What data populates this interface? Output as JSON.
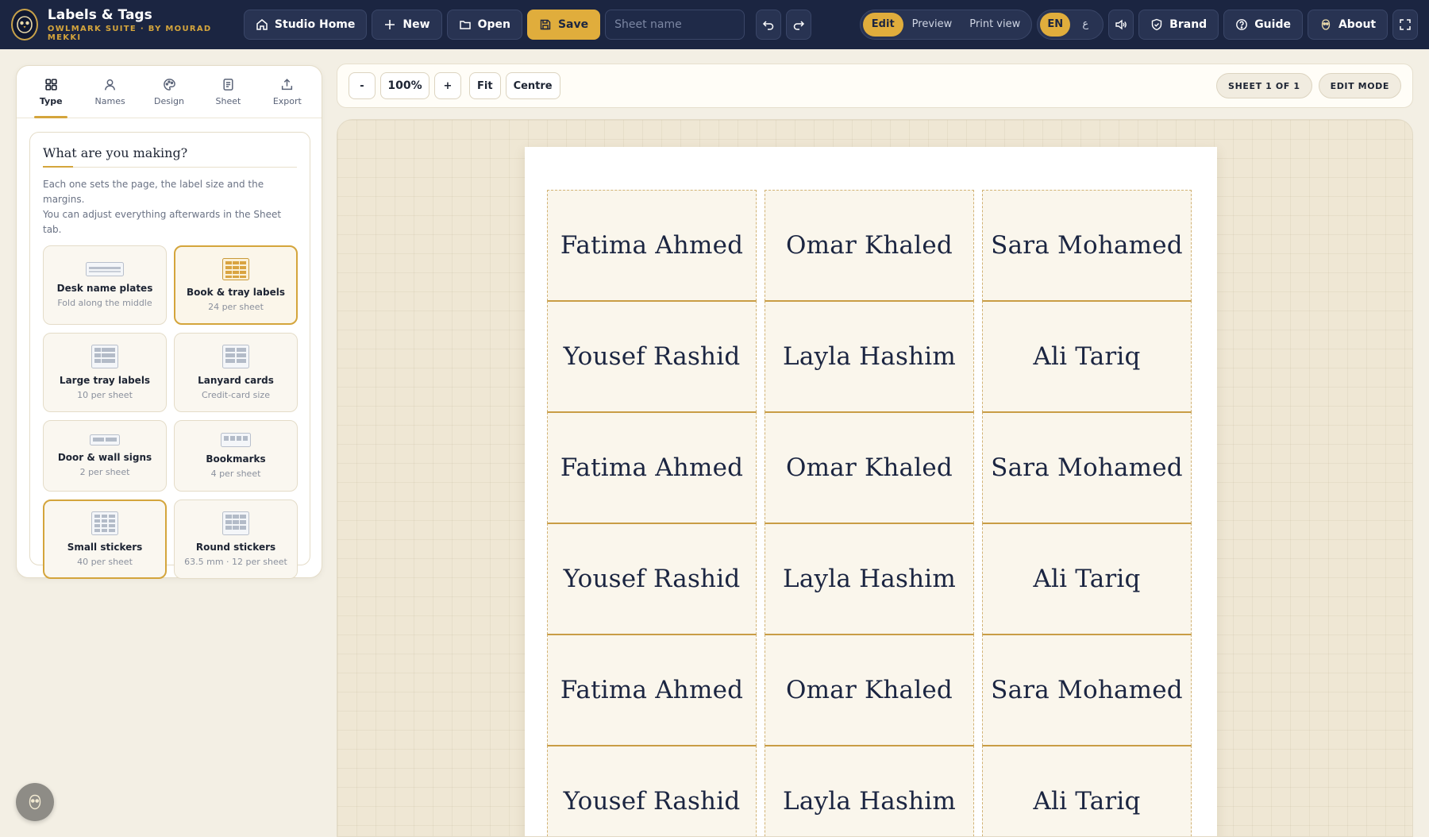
{
  "app": {
    "title": "Labels & Tags",
    "subtitle": "OWLMARK SUITE · BY MOURAD MEKKI"
  },
  "topbar": {
    "studio_home": "Studio Home",
    "new": "New",
    "open": "Open",
    "save": "Save",
    "sheet_name_value": "",
    "sheet_name_placeholder": "Sheet name",
    "modes": [
      "Edit",
      "Preview",
      "Print view"
    ],
    "active_mode": "Edit",
    "languages": [
      "EN",
      "ع"
    ],
    "active_language": "EN",
    "brand": "Brand",
    "guide": "Guide",
    "about": "About"
  },
  "sidebar": {
    "tabs": [
      {
        "label": "Type",
        "icon": "grid-icon",
        "active": true
      },
      {
        "label": "Names",
        "icon": "user-icon",
        "active": false
      },
      {
        "label": "Design",
        "icon": "palette-icon",
        "active": false
      },
      {
        "label": "Sheet",
        "icon": "document-icon",
        "active": false
      },
      {
        "label": "Export",
        "icon": "upload-icon",
        "active": false
      }
    ],
    "heading": "What are you making?",
    "description_line1": "Each one sets the page, the label size and the margins.",
    "description_line2": "You can adjust everything afterwards in the Sheet tab.",
    "types": [
      {
        "name": "Desk name plates",
        "sub": "Fold along the middle"
      },
      {
        "name": "Book & tray labels",
        "sub": "24 per sheet"
      },
      {
        "name": "Large tray labels",
        "sub": "10 per sheet"
      },
      {
        "name": "Lanyard cards",
        "sub": "Credit-card size"
      },
      {
        "name": "Door & wall signs",
        "sub": "2 per sheet"
      },
      {
        "name": "Bookmarks",
        "sub": "4 per sheet"
      },
      {
        "name": "Small stickers",
        "sub": "40 per sheet"
      },
      {
        "name": "Round stickers",
        "sub": "63.5 mm · 12 per sheet"
      }
    ],
    "selected_type": "Book & tray labels"
  },
  "toolbar": {
    "zoom_out": "-",
    "zoom_level": "100%",
    "zoom_in": "+",
    "fit": "Fit",
    "centre": "Centre",
    "sheet_indicator": "SHEET 1 OF 1",
    "mode_indicator": "EDIT MODE"
  },
  "sheet": {
    "labels": [
      "Fatima Ahmed",
      "Omar Khaled",
      "Sara Mohamed",
      "Yousef Rashid",
      "Layla Hashim",
      "Ali Tariq",
      "Fatima Ahmed",
      "Omar Khaled",
      "Sara Mohamed",
      "Yousef Rashid",
      "Layla Hashim",
      "Ali Tariq",
      "Fatima Ahmed",
      "Omar Khaled",
      "Sara Mohamed",
      "Yousef Rashid",
      "Layla Hashim",
      "Ali Tariq"
    ]
  },
  "colors": {
    "navy": "#1b2541",
    "gold": "#d4a53c",
    "save_button": "#e0ad3c",
    "canvas": "#efe7d4"
  }
}
